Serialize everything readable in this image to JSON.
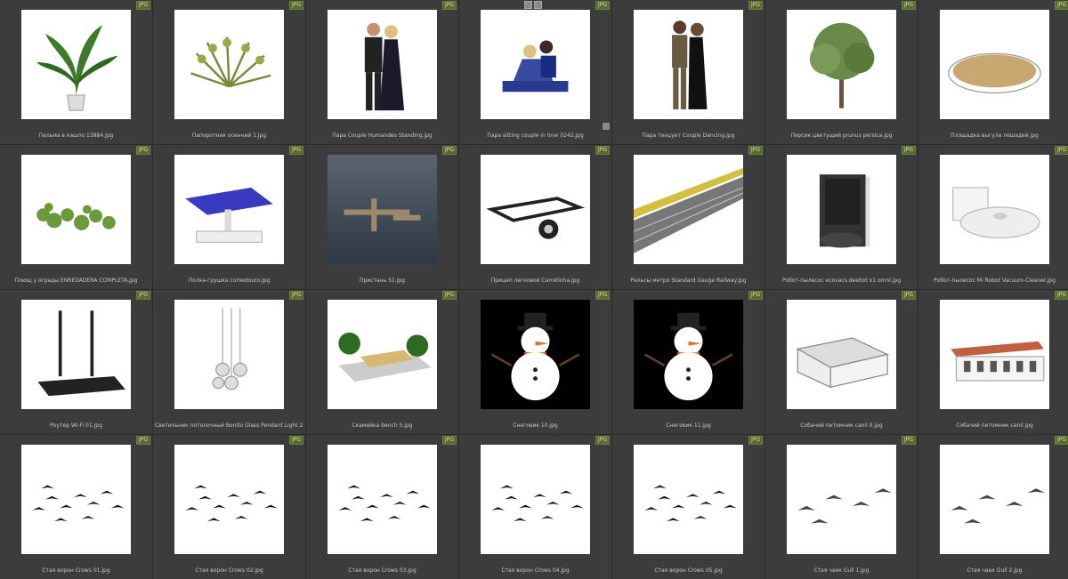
{
  "items": [
    {
      "caption": "Пальма в кашпо 13884.jpg",
      "badge": "JPG",
      "icon": "potted-palm"
    },
    {
      "caption": "Папоротник осенний 1.jpg",
      "badge": "JPG",
      "icon": "fern"
    },
    {
      "caption": "Пара Couple Humandes Standing.jpg",
      "badge": "JPG",
      "icon": "couple-standing"
    },
    {
      "caption": "Пара sitting couple in love 0242.jpg",
      "badge": "JPG",
      "icon": "couple-sitting"
    },
    {
      "caption": "Пара танцует Couple Dancing.jpg",
      "badge": "JPG",
      "icon": "couple-dancing"
    },
    {
      "caption": "Персик цветущий prunus persica.jpg",
      "badge": "JPG",
      "icon": "tree"
    },
    {
      "caption": "Площадка выгула лошадей.jpg",
      "badge": "JPG",
      "icon": "horse-arena"
    },
    {
      "caption": "Плющ у ограды ENREDADERA COMPLETA.jpg",
      "badge": "JPG",
      "icon": "ivy"
    },
    {
      "caption": "Полка-грушка comedouro.jpg",
      "badge": "JPG",
      "icon": "canopy"
    },
    {
      "caption": "Пристань 51.jpg",
      "badge": "JPG",
      "icon": "pier"
    },
    {
      "caption": "Прицеп легковой Carretinha.jpg",
      "badge": "JPG",
      "icon": "trailer"
    },
    {
      "caption": "Рельсы метро Standard Gauge Railway.jpg",
      "badge": "JPG",
      "icon": "railway"
    },
    {
      "caption": "Робот-пылесос ecovacs deebot x1 omni.jpg",
      "badge": "JPG",
      "icon": "robot-station"
    },
    {
      "caption": "Робот-пылесос Mi Robot Vacuum-Cleaner.jpg",
      "badge": "JPG",
      "icon": "robot-vacuum"
    },
    {
      "caption": "Роутер Wi-Fi 01.jpg",
      "badge": "JPG",
      "icon": "router"
    },
    {
      "caption": "Светильник потолочный Bonito Glass Pendant Light 2.jpg",
      "badge": "JPG",
      "icon": "pendant-light"
    },
    {
      "caption": "Скамейка bench 5.jpg",
      "badge": "JPG",
      "icon": "bench"
    },
    {
      "caption": "Снеговик 10.jpg",
      "badge": "JPG",
      "icon": "snowman"
    },
    {
      "caption": "Снеговик 11.jpg",
      "badge": "JPG",
      "icon": "snowman"
    },
    {
      "caption": "Собачий питомник canil 0.jpg",
      "badge": "JPG",
      "icon": "kennel"
    },
    {
      "caption": "Собачий питомник canil.jpg",
      "badge": "JPG",
      "icon": "kennel-house"
    },
    {
      "caption": "Стая ворон Crows 01.jpg",
      "badge": "JPG",
      "icon": "crows"
    },
    {
      "caption": "Стая ворон Crows 02.jpg",
      "badge": "JPG",
      "icon": "crows"
    },
    {
      "caption": "Стая ворон Crows 03.jpg",
      "badge": "JPG",
      "icon": "crows"
    },
    {
      "caption": "Стая ворон Crows 04.jpg",
      "badge": "JPG",
      "icon": "crows"
    },
    {
      "caption": "Стая ворон Crows 05.jpg",
      "badge": "JPG",
      "icon": "crows"
    },
    {
      "caption": "Стая чаек Gull 1.jpg",
      "badge": "JPG",
      "icon": "gulls"
    },
    {
      "caption": "Стая чаек Gull 2.jpg",
      "badge": "JPG",
      "icon": "gulls"
    }
  ]
}
